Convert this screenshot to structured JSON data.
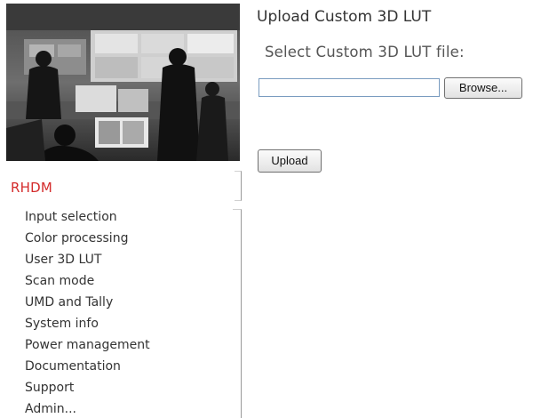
{
  "sidebar": {
    "brand": "RHDM",
    "items": [
      {
        "label": "Input selection"
      },
      {
        "label": "Color processing"
      },
      {
        "label": "User 3D LUT"
      },
      {
        "label": "Scan mode"
      },
      {
        "label": "UMD and Tally"
      },
      {
        "label": "System info"
      },
      {
        "label": "Power management"
      },
      {
        "label": "Documentation"
      },
      {
        "label": "Support"
      },
      {
        "label": "Admin..."
      }
    ]
  },
  "main": {
    "title": "Upload Custom 3D LUT",
    "file_label": "Select Custom 3D LUT file:",
    "file_value": "",
    "browse_label": "Browse...",
    "upload_label": "Upload"
  },
  "colors": {
    "brand": "#d42b2b",
    "nav_text": "#333333",
    "input_border": "#7a9cc0"
  }
}
